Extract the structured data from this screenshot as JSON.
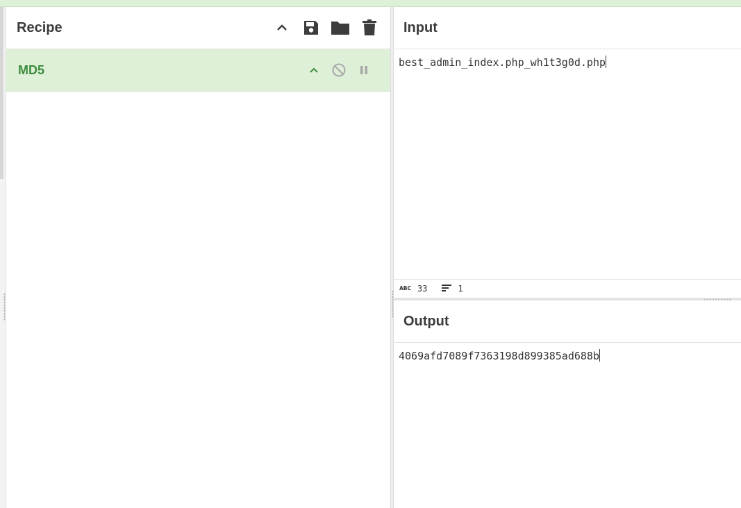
{
  "recipe": {
    "title": "Recipe",
    "icons": [
      "chevron-up-icon",
      "save-icon",
      "folder-icon",
      "trash-icon"
    ],
    "operations": [
      {
        "name": "MD5",
        "icons": [
          "chevron-up-icon",
          "disable-icon",
          "pause-icon"
        ]
      }
    ]
  },
  "input": {
    "title": "Input",
    "text": "best_admin_index.php_wh1t3g0d.php",
    "stats": {
      "length": "33",
      "lines": "1"
    }
  },
  "output": {
    "title": "Output",
    "text": "4069afd7089f7363198d899385ad688b"
  },
  "colors": {
    "banner": "#dff0d8",
    "operation_bg": "#dff0d8",
    "operation_text": "#3c8c3c",
    "icon": "#3d3d3d",
    "muted_icon": "#a8a8a8"
  }
}
